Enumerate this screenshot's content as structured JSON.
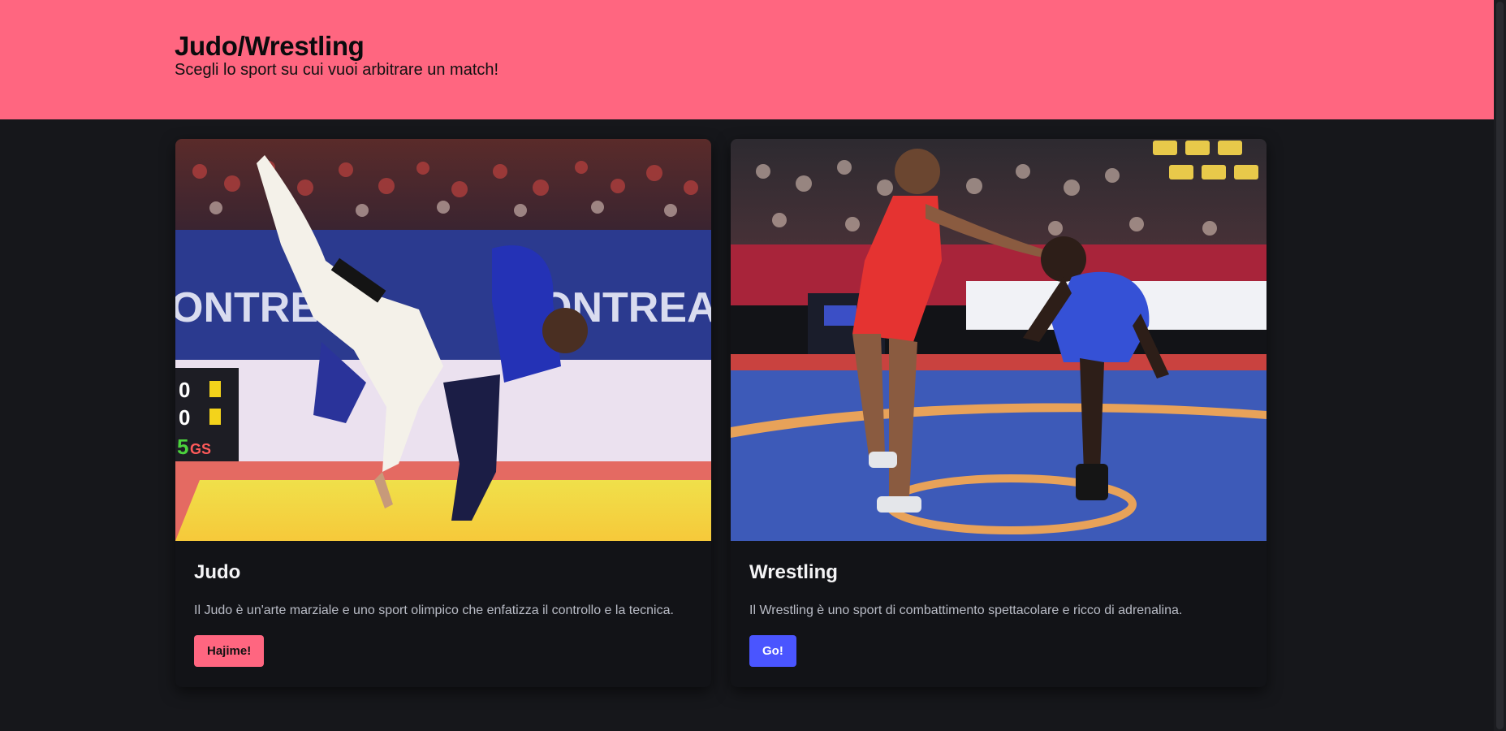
{
  "header": {
    "title": "Judo/Wrestling",
    "subtitle": "Scegli lo sport su cui vuoi arbitrare un match!"
  },
  "cards": [
    {
      "title": "Judo",
      "description": "Il Judo è un'arte marziale e uno sport olimpico che enfatizza il controllo e la tecnica.",
      "button_label": "Hajime!",
      "button_color": "#ff6680",
      "image_alt": "Judo throw photo",
      "image_text": {
        "banner_left": "ONTREAL",
        "banner_right": "ONTREAL",
        "score_1": "0",
        "score_2": "0",
        "score_3": "5",
        "score_gs": "GS"
      }
    },
    {
      "title": "Wrestling",
      "description": "Il Wrestling è uno sport di combattimento spettacolare e ricco di adrenalina.",
      "button_label": "Go!",
      "button_color": "#4a55ff",
      "image_alt": "Wrestling match photo"
    }
  ],
  "colors": {
    "accent_pink": "#ff6680",
    "accent_blue": "#4a55ff",
    "background": "#16171b",
    "card": "#121317"
  }
}
